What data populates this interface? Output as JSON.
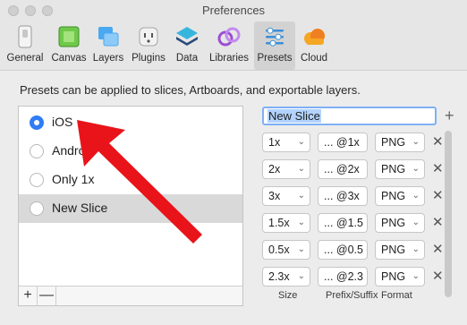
{
  "window": {
    "title": "Preferences"
  },
  "toolbar": {
    "tabs": [
      {
        "label": "General",
        "icon": "switch-icon"
      },
      {
        "label": "Canvas",
        "icon": "canvas-icon"
      },
      {
        "label": "Layers",
        "icon": "layers-icon"
      },
      {
        "label": "Plugins",
        "icon": "plug-icon"
      },
      {
        "label": "Data",
        "icon": "data-icon"
      },
      {
        "label": "Libraries",
        "icon": "libraries-icon"
      },
      {
        "label": "Presets",
        "icon": "presets-icon",
        "active": true
      },
      {
        "label": "Cloud",
        "icon": "cloud-icon"
      }
    ]
  },
  "description": "Presets can be applied to slices, Artboards, and exportable layers.",
  "presets": [
    {
      "label": "iOS",
      "selected": true
    },
    {
      "label": "Android",
      "selected": false
    },
    {
      "label": "Only 1x",
      "selected": false
    },
    {
      "label": "New Slice",
      "selected": false,
      "highlighted": true
    }
  ],
  "list_footer": {
    "add": "+",
    "remove": "—"
  },
  "editor": {
    "name_value": "New Slice",
    "add_symbol": "+",
    "remove_symbol": "✕",
    "rows": [
      {
        "size": "1x",
        "prefix": "... @1x",
        "format": "PNG"
      },
      {
        "size": "2x",
        "prefix": "... @2x",
        "format": "PNG"
      },
      {
        "size": "3x",
        "prefix": "... @3x",
        "format": "PNG"
      },
      {
        "size": "1.5x",
        "prefix": "... @1.5",
        "format": "PNG"
      },
      {
        "size": "0.5x",
        "prefix": "... @0.5",
        "format": "PNG"
      },
      {
        "size": "2.3x",
        "prefix": "... @2.3",
        "format": "PNG"
      }
    ],
    "columns": {
      "size": "Size",
      "prefix": "Prefix/Suffix",
      "format": "Format"
    }
  },
  "colors": {
    "accent": "#2f7cf6",
    "annotation_arrow": "#e8141a"
  }
}
